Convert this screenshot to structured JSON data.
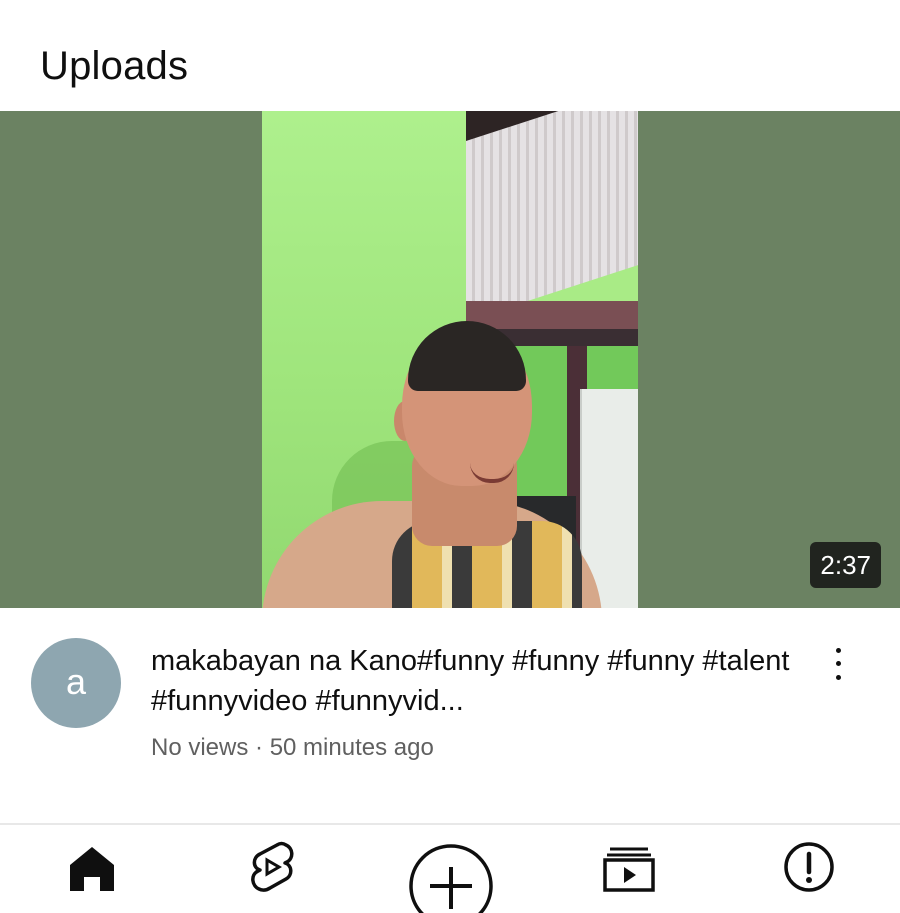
{
  "section": {
    "title": "Uploads"
  },
  "video": {
    "duration": "2:37",
    "title": "makabayan na Kano#funny #funny #funny #talent #funnyvideo #funnyvid...",
    "meta": "No views · 50 minutes ago",
    "channel_initial": "a"
  },
  "nav": {
    "items": [
      {
        "icon": "home-icon"
      },
      {
        "icon": "shorts-icon"
      },
      {
        "icon": "create-plus-icon"
      },
      {
        "icon": "subscriptions-icon"
      },
      {
        "icon": "alert-icon"
      }
    ]
  },
  "colors": {
    "thumbnail_bg": "#6b8262",
    "avatar_bg": "#8ea6b0",
    "meta_text": "#606060"
  }
}
